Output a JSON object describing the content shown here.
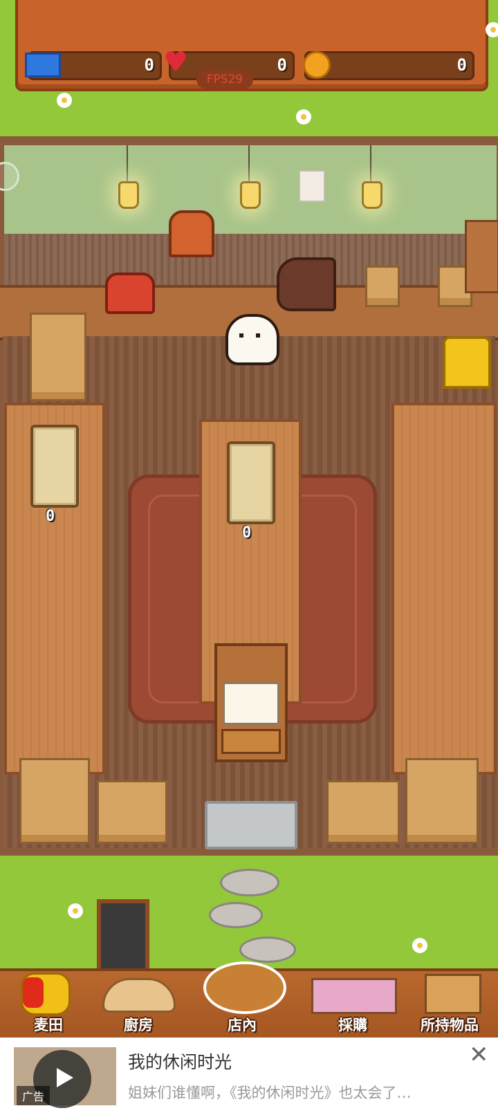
{
  "hud": {
    "tickets": "0",
    "hearts": "0",
    "coins": "0",
    "fps": "FPS29"
  },
  "tables": [
    {
      "count": "0"
    },
    {
      "count": "0"
    }
  ],
  "nav": [
    {
      "label": "麦田",
      "icon": "wheat-icon"
    },
    {
      "label": "廚房",
      "icon": "kitchen-icon"
    },
    {
      "label": "店內",
      "icon": "bread-basket-icon"
    },
    {
      "label": "採購",
      "icon": "shopping-icon"
    },
    {
      "label": "所持物品",
      "icon": "box-icon"
    }
  ],
  "ad": {
    "title": "我的休闲时光",
    "description": "姐妹们谁懂啊，《我的休闲时光》也太会了…",
    "tag": "广告",
    "close": "✕"
  },
  "colors": {
    "grass": "#92c83a",
    "wood": "#c8642a",
    "fps_text": "#d84a3a"
  }
}
